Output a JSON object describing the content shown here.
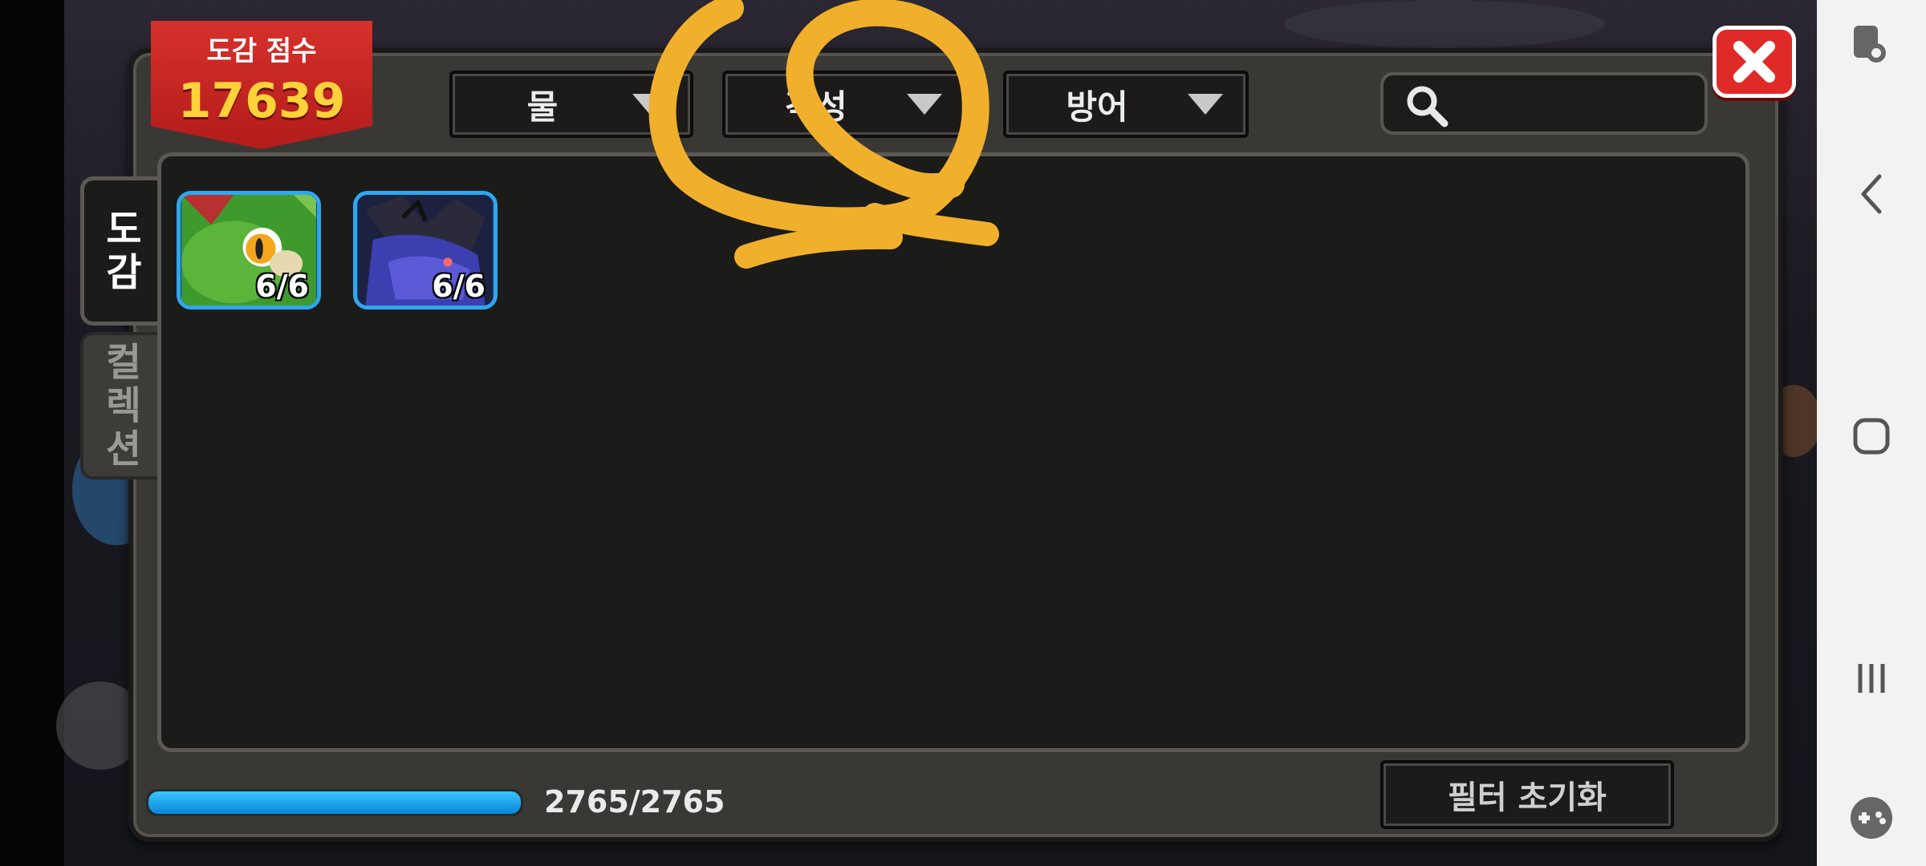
{
  "score": {
    "label": "도감 점수",
    "value": "17639"
  },
  "filters": [
    {
      "label": "물"
    },
    {
      "label": "각성"
    },
    {
      "label": "방어"
    }
  ],
  "search": {
    "placeholder": ""
  },
  "tabs": [
    {
      "label_lines": [
        "도",
        "감"
      ],
      "active": true
    },
    {
      "label_lines": [
        "컬",
        "렉",
        "션"
      ],
      "active": false
    }
  ],
  "cards": [
    {
      "name": "green-dragon",
      "count": "6/6"
    },
    {
      "name": "dark-dragon",
      "count": "6/6"
    }
  ],
  "progress": {
    "text": "2765/2765",
    "fraction": 1.0
  },
  "reset_button": {
    "label": "필터 초기화"
  },
  "colors": {
    "accent": "#2fa7ee",
    "close": "#e02a28",
    "badge": "#c3221f",
    "annotation": "#f1b02c"
  },
  "nav_icons": [
    "screen-touch-icon",
    "back-icon",
    "home-icon",
    "recents-icon",
    "game-tools-icon"
  ]
}
